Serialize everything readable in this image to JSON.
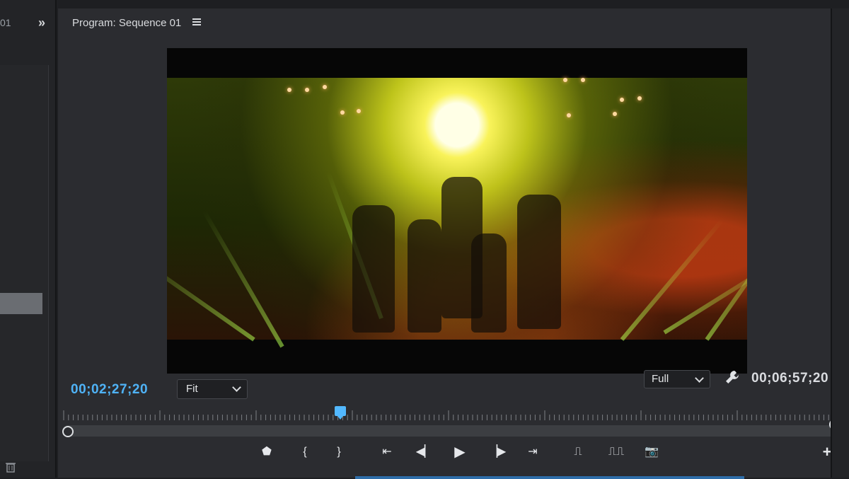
{
  "left_panel": {
    "tab_fragment": "01",
    "collapse_glyph": "»",
    "trash_icon": "trash-icon"
  },
  "monitor": {
    "title": "Program: Sequence 01",
    "menu_icon": "hamburger-menu-icon"
  },
  "playback": {
    "current_timecode": "00;02;27;20",
    "zoom_select": "Fit",
    "resolution_select": "Full",
    "settings_icon": "wrench-icon",
    "duration_timecode": "00;06;57;20",
    "playhead_fraction": 0.36
  },
  "transport": {
    "buttons": [
      {
        "name": "add-marker-button",
        "glyph": "⬟"
      },
      {
        "name": "mark-in-button",
        "glyph": "{"
      },
      {
        "name": "mark-out-button",
        "glyph": "}"
      },
      {
        "name": "go-to-in-button",
        "glyph": "⇤"
      },
      {
        "name": "step-back-button",
        "glyph": "◀▏"
      },
      {
        "name": "play-button",
        "glyph": "▶"
      },
      {
        "name": "step-forward-button",
        "glyph": "▕▶"
      },
      {
        "name": "go-to-out-button",
        "glyph": "⇥"
      },
      {
        "name": "lift-button",
        "glyph": "⎍"
      },
      {
        "name": "extract-button",
        "glyph": "⎍⎍"
      },
      {
        "name": "export-frame-button",
        "glyph": "📷"
      }
    ],
    "add_button_glyph": "+"
  },
  "colors": {
    "accent_blue": "#4fb3f7",
    "panel_bg": "#2b2c30"
  }
}
